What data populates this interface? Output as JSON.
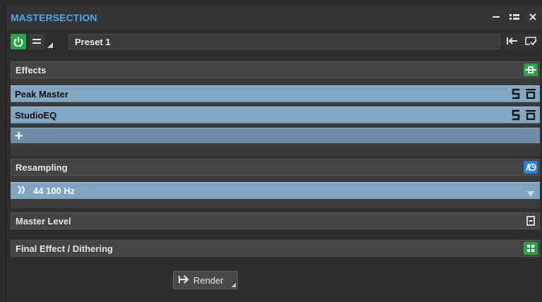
{
  "window": {
    "title": "MASTERSECTION"
  },
  "preset": {
    "name": "Preset 1"
  },
  "effects": {
    "header": "Effects",
    "plugins": [
      {
        "name": "Peak Master"
      },
      {
        "name": "StudioEQ"
      }
    ],
    "add_label": "+"
  },
  "resampling": {
    "header": "Resampling",
    "rate": "44 100 Hz"
  },
  "master_level": {
    "header": "Master Level"
  },
  "final_effect": {
    "header": "Final Effect / Dithering"
  },
  "render": {
    "label": "Render"
  },
  "colors": {
    "title_blue": "#49a8f2",
    "power_green": "#27a645",
    "plugin_blue": "#82a7c2",
    "resample_icon": "#2a7fd4"
  },
  "icons": {
    "power": "power-icon",
    "menu": "menu-icon",
    "minimize": "minimize-icon",
    "list": "list-icon",
    "close": "close-icon",
    "back": "back-to-start-icon",
    "save": "save-preset-icon",
    "effects_chain": "effects-chain-icon",
    "solo": "solo-icon",
    "bypass": "bypass-icon",
    "resampling": "resampling-icon",
    "dropdown": "dropdown-arrow-icon",
    "master_level": "master-level-icon",
    "dithering": "dithering-icon",
    "render": "render-icon"
  }
}
